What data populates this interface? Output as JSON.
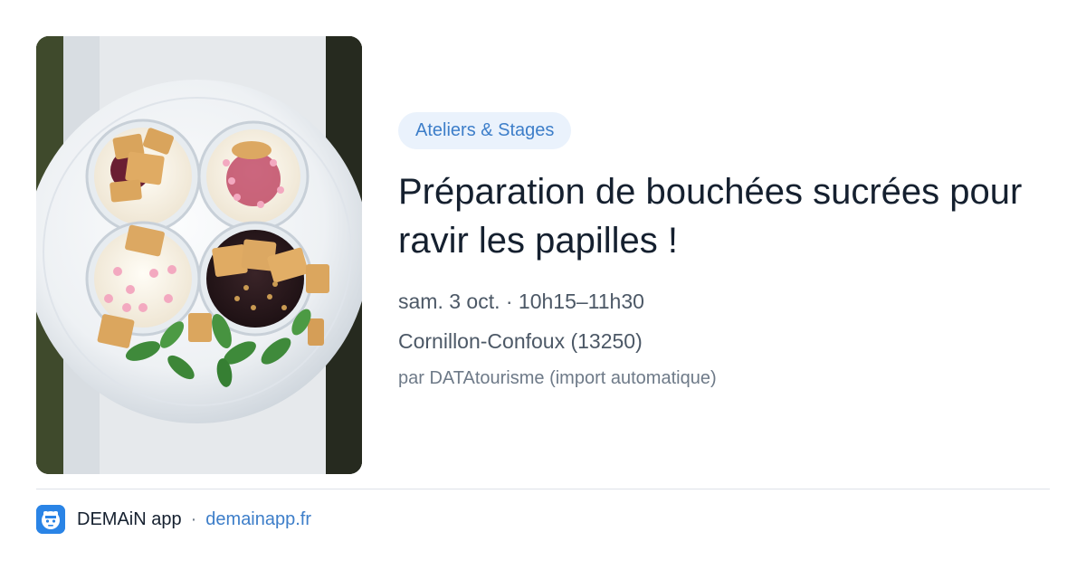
{
  "event": {
    "category": "Ateliers & Stages",
    "title": "Préparation de bouchées sucrées pour ravir les papilles !",
    "datetime": "sam. 3 oct. · 10h15–11h30",
    "location": "Cornillon-Confoux (13250)",
    "source": "par DATAtourisme (import automatique)"
  },
  "footer": {
    "app_name": "DEMAiN app",
    "separator": "·",
    "domain": "demainapp.fr"
  },
  "image": {
    "subject": "plate-of-dessert-verrines-icon"
  },
  "colors": {
    "accent": "#3d7ec9",
    "badge_bg": "#eaf2fc",
    "title": "#15202f",
    "meta": "#4c5866",
    "logo": "#2a84e6"
  }
}
